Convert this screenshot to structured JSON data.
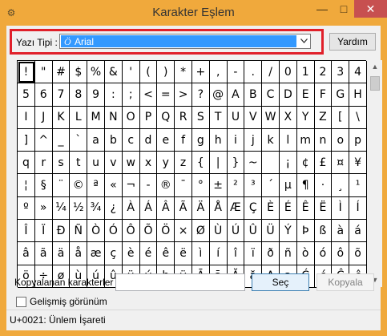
{
  "window": {
    "title": "Karakter Eşlem",
    "min_glyph": "—",
    "max_glyph": "□",
    "close_glyph": "✕",
    "app_glyph": "⚙"
  },
  "font": {
    "label": "Yazı Tipi :",
    "selected": "Arial",
    "type_glyph": "Ö"
  },
  "help_button": "Yardım",
  "characters": [
    "!",
    "\"",
    "#",
    "$",
    "%",
    "&",
    "'",
    "(",
    ")",
    "*",
    "+",
    ",",
    "-",
    ".",
    "/",
    "0",
    "1",
    "2",
    "3",
    "4",
    "5",
    "6",
    "7",
    "8",
    "9",
    ":",
    ";",
    "<",
    "=",
    ">",
    "?",
    "@",
    "A",
    "B",
    "C",
    "D",
    "E",
    "F",
    "G",
    "H",
    "I",
    "J",
    "K",
    "L",
    "M",
    "N",
    "O",
    "P",
    "Q",
    "R",
    "S",
    "T",
    "U",
    "V",
    "W",
    "X",
    "Y",
    "Z",
    "[",
    "\\",
    "]",
    "^",
    "_",
    "`",
    "a",
    "b",
    "c",
    "d",
    "e",
    "f",
    "g",
    "h",
    "i",
    "j",
    "k",
    "l",
    "m",
    "n",
    "o",
    "p",
    "q",
    "r",
    "s",
    "t",
    "u",
    "v",
    "w",
    "x",
    "y",
    "z",
    "{",
    "|",
    "}",
    "~",
    " ",
    "¡",
    "¢",
    "£",
    "¤",
    "¥",
    "¦",
    "§",
    "¨",
    "©",
    "ª",
    "«",
    "¬",
    "-",
    "®",
    "¯",
    "°",
    "±",
    "²",
    "³",
    "´",
    "µ",
    "¶",
    "·",
    "¸",
    "¹",
    "º",
    "»",
    "¼",
    "½",
    "¾",
    "¿",
    "À",
    "Á",
    "Â",
    "Ã",
    "Ä",
    "Å",
    "Æ",
    "Ç",
    "È",
    "É",
    "Ê",
    "Ë",
    "Ì",
    "Í",
    "Î",
    "Ï",
    "Ð",
    "Ñ",
    "Ò",
    "Ó",
    "Ô",
    "Õ",
    "Ö",
    "×",
    "Ø",
    "Ù",
    "Ú",
    "Û",
    "Ü",
    "Ý",
    "Þ",
    "ß",
    "à",
    "á",
    "â",
    "ã",
    "ä",
    "å",
    "æ",
    "ç",
    "è",
    "é",
    "ê",
    "ë",
    "ì",
    "í",
    "î",
    "ï",
    "ð",
    "ñ",
    "ò",
    "ó",
    "ô",
    "õ",
    "ö",
    "÷",
    "ø",
    "ù",
    "ú",
    "û",
    "ü",
    "ý",
    "þ",
    "ÿ",
    "Ā",
    "ā",
    "Ă",
    "ă",
    "Ą",
    "ą",
    "Ć",
    "ć",
    "Ĉ",
    "ĉ"
  ],
  "selected_index": 0,
  "copy": {
    "label": "Kopyalanan karakterler :",
    "value": "",
    "select_button": "Seç",
    "copy_button": "Kopyala"
  },
  "advanced_view": {
    "label": "Gelişmiş görünüm",
    "checked": false
  },
  "status": "U+0021: Ünlem İşareti",
  "scroll": {
    "up_glyph": "▲",
    "down_glyph": "▼"
  }
}
